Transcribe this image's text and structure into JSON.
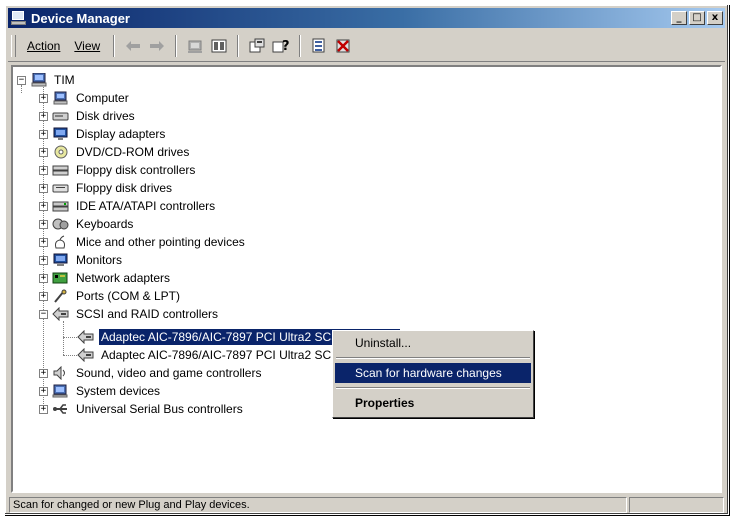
{
  "window": {
    "title": "Device Manager",
    "minimize": "_",
    "maximize": "□",
    "close": "x"
  },
  "menu": {
    "action": "Action",
    "view": "View"
  },
  "toolbar": {
    "icons": [
      "back-arrow-icon",
      "forward-arrow-icon",
      "computer-view-icon",
      "device-view-icon",
      "properties-icon",
      "help-icon",
      "scan-hardware-icon",
      "uninstall-icon"
    ]
  },
  "tree": {
    "root": "TIM",
    "items": [
      {
        "label": "Computer",
        "icon": "computer-icon",
        "expander": "+"
      },
      {
        "label": "Disk drives",
        "icon": "disk-drive-icon",
        "expander": "+"
      },
      {
        "label": "Display adapters",
        "icon": "display-adapter-icon",
        "expander": "+"
      },
      {
        "label": "DVD/CD-ROM drives",
        "icon": "cdrom-icon",
        "expander": "+"
      },
      {
        "label": "Floppy disk controllers",
        "icon": "floppy-controller-icon",
        "expander": "+"
      },
      {
        "label": "Floppy disk drives",
        "icon": "floppy-drive-icon",
        "expander": "+"
      },
      {
        "label": "IDE ATA/ATAPI controllers",
        "icon": "ide-controller-icon",
        "expander": "+"
      },
      {
        "label": "Keyboards",
        "icon": "keyboard-icon",
        "expander": "+"
      },
      {
        "label": "Mice and other pointing devices",
        "icon": "mouse-icon",
        "expander": "+"
      },
      {
        "label": "Monitors",
        "icon": "monitor-icon",
        "expander": "+"
      },
      {
        "label": "Network adapters",
        "icon": "network-adapter-icon",
        "expander": "+"
      },
      {
        "label": "Ports (COM & LPT)",
        "icon": "port-icon",
        "expander": "+"
      },
      {
        "label": "SCSI and RAID controllers",
        "icon": "scsi-icon",
        "expander": "−"
      },
      {
        "label": "Sound, video and game controllers",
        "icon": "sound-icon",
        "expander": "+"
      },
      {
        "label": "System devices",
        "icon": "system-device-icon",
        "expander": "+"
      },
      {
        "label": "Universal Serial Bus controllers",
        "icon": "usb-icon",
        "expander": "+"
      }
    ],
    "scsi_children": [
      "Adaptec AIC-7896/AIC-7897 PCI Ultra2 SCSI Controller",
      "Adaptec AIC-7896/AIC-7897 PCI Ultra2 SC"
    ]
  },
  "context_menu": {
    "uninstall": "Uninstall...",
    "scan": "Scan for hardware changes",
    "properties": "Properties"
  },
  "status": {
    "text": "Scan for changed or new Plug and Play devices."
  },
  "colors": {
    "highlight": "#0a246a",
    "face": "#d4d0c8"
  }
}
